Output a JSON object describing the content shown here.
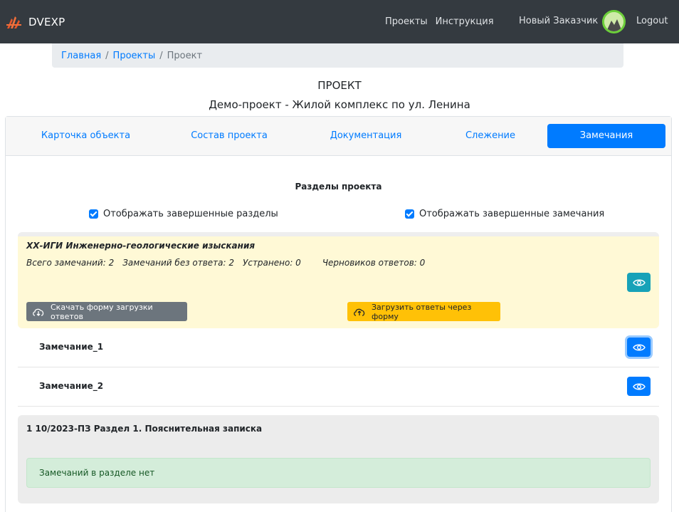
{
  "navbar": {
    "brand": "DVEXP",
    "links": [
      "Проекты",
      "Инструкция"
    ],
    "customer": "Новый Заказчик",
    "logout": "Logout"
  },
  "breadcrumb": {
    "home": "Главная",
    "projects": "Проекты",
    "current": "Проект",
    "separator": "/"
  },
  "page": {
    "title": "ПРОЕКТ",
    "subtitle": "Демо-проект - Жилой комплекс по ул. Ленина"
  },
  "tabs": [
    {
      "label": "Карточка объекта"
    },
    {
      "label": "Состав проекта"
    },
    {
      "label": "Документация"
    },
    {
      "label": "Слежение"
    },
    {
      "label": "Замечания",
      "active": true
    }
  ],
  "sections_title": "Разделы проекта",
  "filters": {
    "show_completed_sections": "Отображать завершенные разделы",
    "show_completed_remarks": "Отображать завершенные замечания"
  },
  "section1": {
    "title": "ХХ-ИГИ Инженерно-геологические изыскания",
    "stats": {
      "total": "Всего замечаний: 2",
      "unanswered": "Замечаний без ответа: 2",
      "fixed": "Устранено: 0",
      "drafts": "Черновиков ответов: 0"
    },
    "download_button": "Скачать форму загрузки ответов",
    "upload_button": "Загрузить ответы через форму",
    "remarks": [
      {
        "label": "Замечание_1"
      },
      {
        "label": "Замечание_2"
      }
    ]
  },
  "section2": {
    "title": "1 10/2023-ПЗ Раздел 1. Пояснительная записка",
    "empty_message": "Замечаний в разделе нет"
  },
  "colors": {
    "navbar_bg": "#343a40",
    "primary": "#007bff",
    "info": "#17a2b8",
    "warning": "#ffc107",
    "secondary": "#6c757d",
    "success_bg": "#d4edda",
    "section_highlight": "#fff9d6"
  }
}
